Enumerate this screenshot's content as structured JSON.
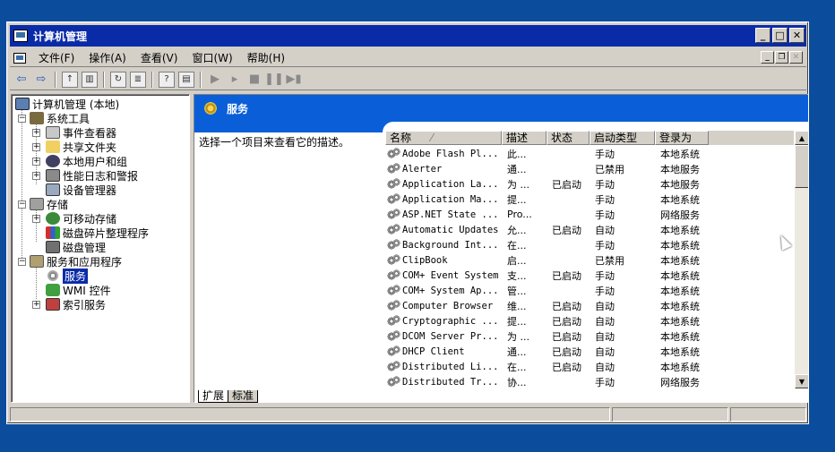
{
  "window": {
    "title": "计算机管理"
  },
  "menu": [
    "文件(F)",
    "操作(A)",
    "查看(V)",
    "窗口(W)",
    "帮助(H)"
  ],
  "tree": [
    {
      "label": "计算机管理 (本地)",
      "indent": 0,
      "exp": ""
    },
    {
      "label": "系统工具",
      "indent": 1,
      "exp": "−"
    },
    {
      "label": "事件查看器",
      "indent": 2,
      "exp": "+"
    },
    {
      "label": "共享文件夹",
      "indent": 2,
      "exp": "+"
    },
    {
      "label": "本地用户和组",
      "indent": 2,
      "exp": "+"
    },
    {
      "label": "性能日志和警报",
      "indent": 2,
      "exp": "+"
    },
    {
      "label": "设备管理器",
      "indent": 2,
      "exp": ""
    },
    {
      "label": "存储",
      "indent": 1,
      "exp": "−"
    },
    {
      "label": "可移动存储",
      "indent": 2,
      "exp": "+"
    },
    {
      "label": "磁盘碎片整理程序",
      "indent": 2,
      "exp": ""
    },
    {
      "label": "磁盘管理",
      "indent": 2,
      "exp": ""
    },
    {
      "label": "服务和应用程序",
      "indent": 1,
      "exp": "−"
    },
    {
      "label": "服务",
      "indent": 2,
      "exp": "",
      "selected": true
    },
    {
      "label": "WMI 控件",
      "indent": 2,
      "exp": ""
    },
    {
      "label": "索引服务",
      "indent": 2,
      "exp": "+"
    }
  ],
  "panel": {
    "title": "服务",
    "description": "选择一个项目来查看它的描述。"
  },
  "columns": [
    "名称",
    "描述",
    "状态",
    "启动类型",
    "登录为"
  ],
  "services": [
    [
      "Adobe Flash Pl...",
      "此...",
      "",
      "手动",
      "本地系统"
    ],
    [
      "Alerter",
      "通...",
      "",
      "已禁用",
      "本地服务"
    ],
    [
      "Application La...",
      "为 ...",
      "已启动",
      "手动",
      "本地服务"
    ],
    [
      "Application Ma...",
      "提...",
      "",
      "手动",
      "本地系统"
    ],
    [
      "ASP.NET State ...",
      "Pro...",
      "",
      "手动",
      "网络服务"
    ],
    [
      "Automatic Updates",
      "允...",
      "已启动",
      "自动",
      "本地系统"
    ],
    [
      "Background Int...",
      "在...",
      "",
      "手动",
      "本地系统"
    ],
    [
      "ClipBook",
      "启...",
      "",
      "已禁用",
      "本地系统"
    ],
    [
      "COM+ Event System",
      "支...",
      "已启动",
      "手动",
      "本地系统"
    ],
    [
      "COM+ System Ap...",
      "管...",
      "",
      "手动",
      "本地系统"
    ],
    [
      "Computer Browser",
      "维...",
      "已启动",
      "自动",
      "本地系统"
    ],
    [
      "Cryptographic ...",
      "提...",
      "已启动",
      "自动",
      "本地系统"
    ],
    [
      "DCOM Server Pr...",
      "为 ...",
      "已启动",
      "自动",
      "本地系统"
    ],
    [
      "DHCP Client",
      "通...",
      "已启动",
      "自动",
      "本地系统"
    ],
    [
      "Distributed Li...",
      "在...",
      "已启动",
      "自动",
      "本地系统"
    ],
    [
      "Distributed Tr...",
      "协...",
      "",
      "手动",
      "网络服务"
    ]
  ],
  "tabs": [
    "扩展",
    "标准"
  ],
  "colors": {
    "title": "#0a2ba8",
    "header": "#0a5fd8",
    "desktop": "#0c4c9c"
  }
}
